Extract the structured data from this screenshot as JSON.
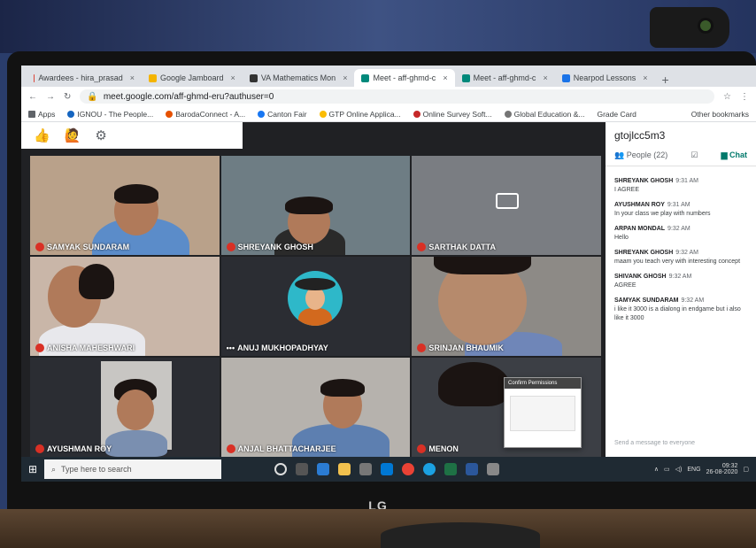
{
  "browser": {
    "tabs": [
      {
        "label": "Awardees - hira_prasad",
        "color": "#db4437"
      },
      {
        "label": "Google Jamboard",
        "color": "#f4b400"
      },
      {
        "label": "VA Mathematics Mon",
        "color": "#333333"
      },
      {
        "label": "Meet - aff-ghmd-c",
        "color": "#00897b",
        "active": true
      },
      {
        "label": "Meet - aff-ghmd-c",
        "color": "#00897b"
      },
      {
        "label": "Nearpod Lessons",
        "color": "#1a73e8"
      }
    ],
    "new_tab": "+",
    "url": "meet.google.com/aff-ghmd-eru?authuser=0",
    "bookmarks": [
      "Apps",
      "IGNOU - The People...",
      "BarodaConnect - A...",
      "Canton Fair",
      "GTP Online Applica...",
      "Online Survey Soft...",
      "Global Education &...",
      "Grade Card"
    ],
    "other_bookmarks": "Other bookmarks"
  },
  "meet": {
    "reactions": [
      "👍",
      "🙋"
    ],
    "participants": [
      {
        "name": "SAMYAK SUNDARAM",
        "bg": "#b9a18a",
        "muted": true
      },
      {
        "name": "SHREYANK GHOSH",
        "bg": "#6e7d84",
        "muted": true
      },
      {
        "name": "SARTHAK DATTA",
        "bg": "#7a7d82",
        "muted": true
      },
      {
        "name": "ANISHA MAHESHWARI",
        "bg": "#c9b6a8",
        "muted": true
      },
      {
        "name": "ANUJ MUKHOPADHYAY",
        "bg": "#2b2d33",
        "muted": false
      },
      {
        "name": "SRINJAN BHAUMIK",
        "bg": "#8d8a86",
        "muted": true
      },
      {
        "name": "AYUSHMAN ROY",
        "bg": "#c8c6c3",
        "muted": true
      },
      {
        "name": "ANJAL BHATTACHARJEE",
        "bg": "#b6b2ad",
        "muted": true
      },
      {
        "name": "MENON",
        "bg": "#3c3f45",
        "muted": true
      }
    ]
  },
  "sidebar": {
    "meeting_code": "gtojlcc5m3",
    "people_label": "People (22)",
    "chat_label": "Chat",
    "messages": [
      {
        "who": "SHREYANK GHOSH",
        "time": "9:31 AM",
        "text": "I AGREE"
      },
      {
        "who": "AYUSHMAN ROY",
        "time": "9:31 AM",
        "text": "In your class we play with numbers"
      },
      {
        "who": "ARPAN MONDAL",
        "time": "9:32 AM",
        "text": "Hello"
      },
      {
        "who": "SHREYANK GHOSH",
        "time": "9:32 AM",
        "text": "maam you teach very with interesting concept"
      },
      {
        "who": "SHIVANK GHOSH",
        "time": "9:32 AM",
        "text": "AGREE"
      },
      {
        "who": "SAMYAK SUNDARAM",
        "time": "9:32 AM",
        "text": "i like it 3000 is a dialong in endgame but i also like it 3000"
      }
    ],
    "send_placeholder": "Send a message to everyone"
  },
  "dialog": {
    "title": "Confirm Permissions"
  },
  "taskbar": {
    "search_placeholder": "Type here to search",
    "lang": "ENG",
    "time": "09:32",
    "date": "26-08-2020"
  },
  "monitor_brand": "LG"
}
